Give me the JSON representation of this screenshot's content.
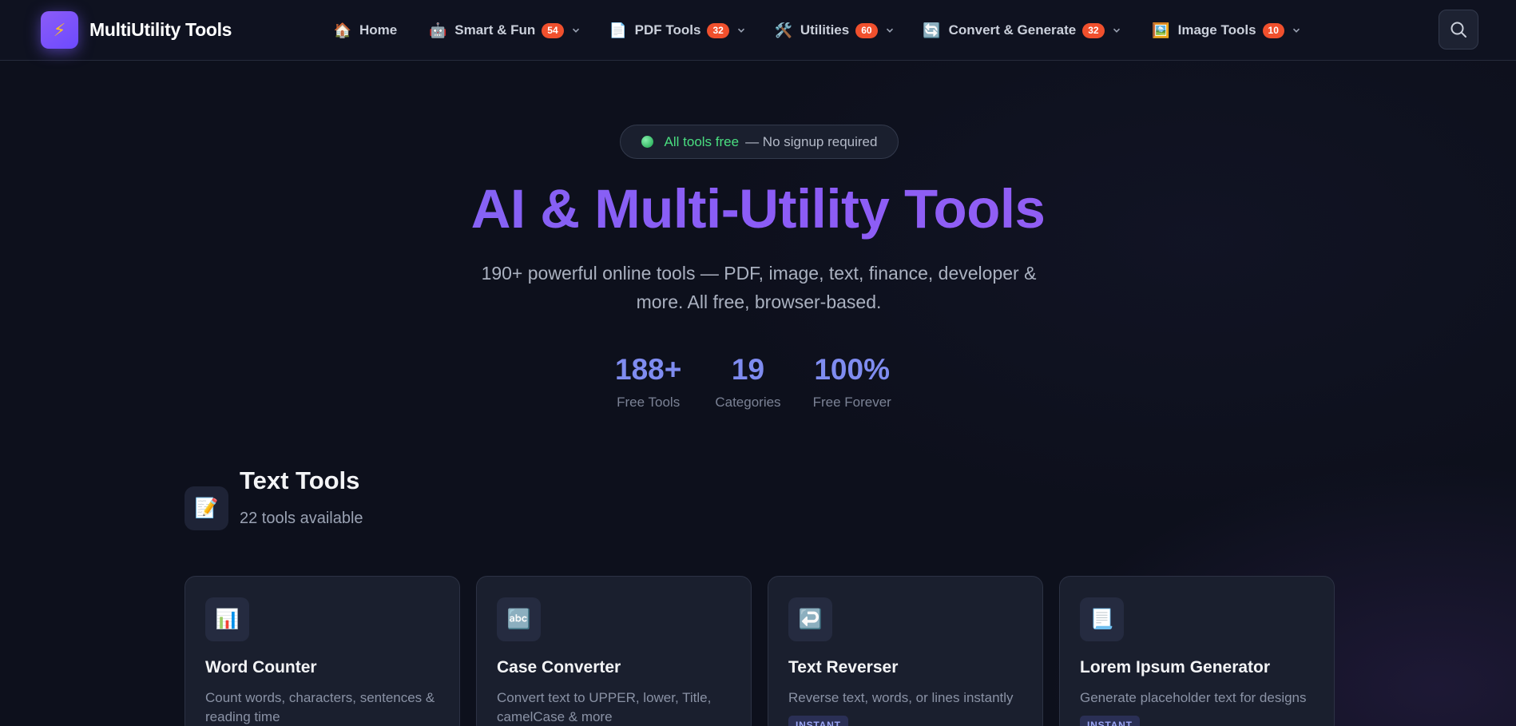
{
  "brand": {
    "name": "MultiUtility Tools",
    "logo_icon": "lightning-bolt-icon"
  },
  "nav": {
    "items": [
      {
        "label": "Home",
        "icon": "house-icon"
      },
      {
        "label": "Smart & Fun",
        "icon": "robot-icon",
        "badge": "54"
      },
      {
        "label": "PDF Tools",
        "icon": "page-icon",
        "badge": "32"
      },
      {
        "label": "Utilities",
        "icon": "tools-icon",
        "badge": "60"
      },
      {
        "label": "Convert & Generate",
        "icon": "arrows-cycle-icon",
        "badge": "32"
      },
      {
        "label": "Image Tools",
        "icon": "picture-icon",
        "badge": "10"
      }
    ],
    "search_icon": "search-icon"
  },
  "hero": {
    "pill_highlight": "All tools free",
    "pill_text": "— No signup required",
    "title": "AI & Multi-Utility Tools",
    "subtitle": "190+ powerful online tools — PDF, image, text, finance, developer & more. All free, browser-based."
  },
  "stats": [
    {
      "value": "188+",
      "label": "Free Tools"
    },
    {
      "value": "19",
      "label": "Categories"
    },
    {
      "value": "100%",
      "label": "Free Forever"
    }
  ],
  "section": {
    "title": "Text Tools",
    "count": "22 tools available",
    "icon": "memo-icon"
  },
  "cards": [
    {
      "title": "Word Counter",
      "description": "Count words, characters, sentences & reading time",
      "icon": "bar-chart-icon",
      "tag": ""
    },
    {
      "title": "Case Converter",
      "description": "Convert text to UPPER, lower, Title, camelCase & more",
      "icon": "abc-icon",
      "tag": ""
    },
    {
      "title": "Text Reverser",
      "description": "Reverse text, words, or lines instantly",
      "icon": "return-arrow-icon",
      "tag": "INSTANT"
    },
    {
      "title": "Lorem Ipsum Generator",
      "description": "Generate placeholder text for designs",
      "icon": "document-icon",
      "tag": "INSTANT"
    }
  ],
  "colors": {
    "background": "#0d101c",
    "accent": "#8b5cf6",
    "badge": "#f0502d",
    "stat": "#7f8cf0",
    "success": "#4ade80"
  }
}
